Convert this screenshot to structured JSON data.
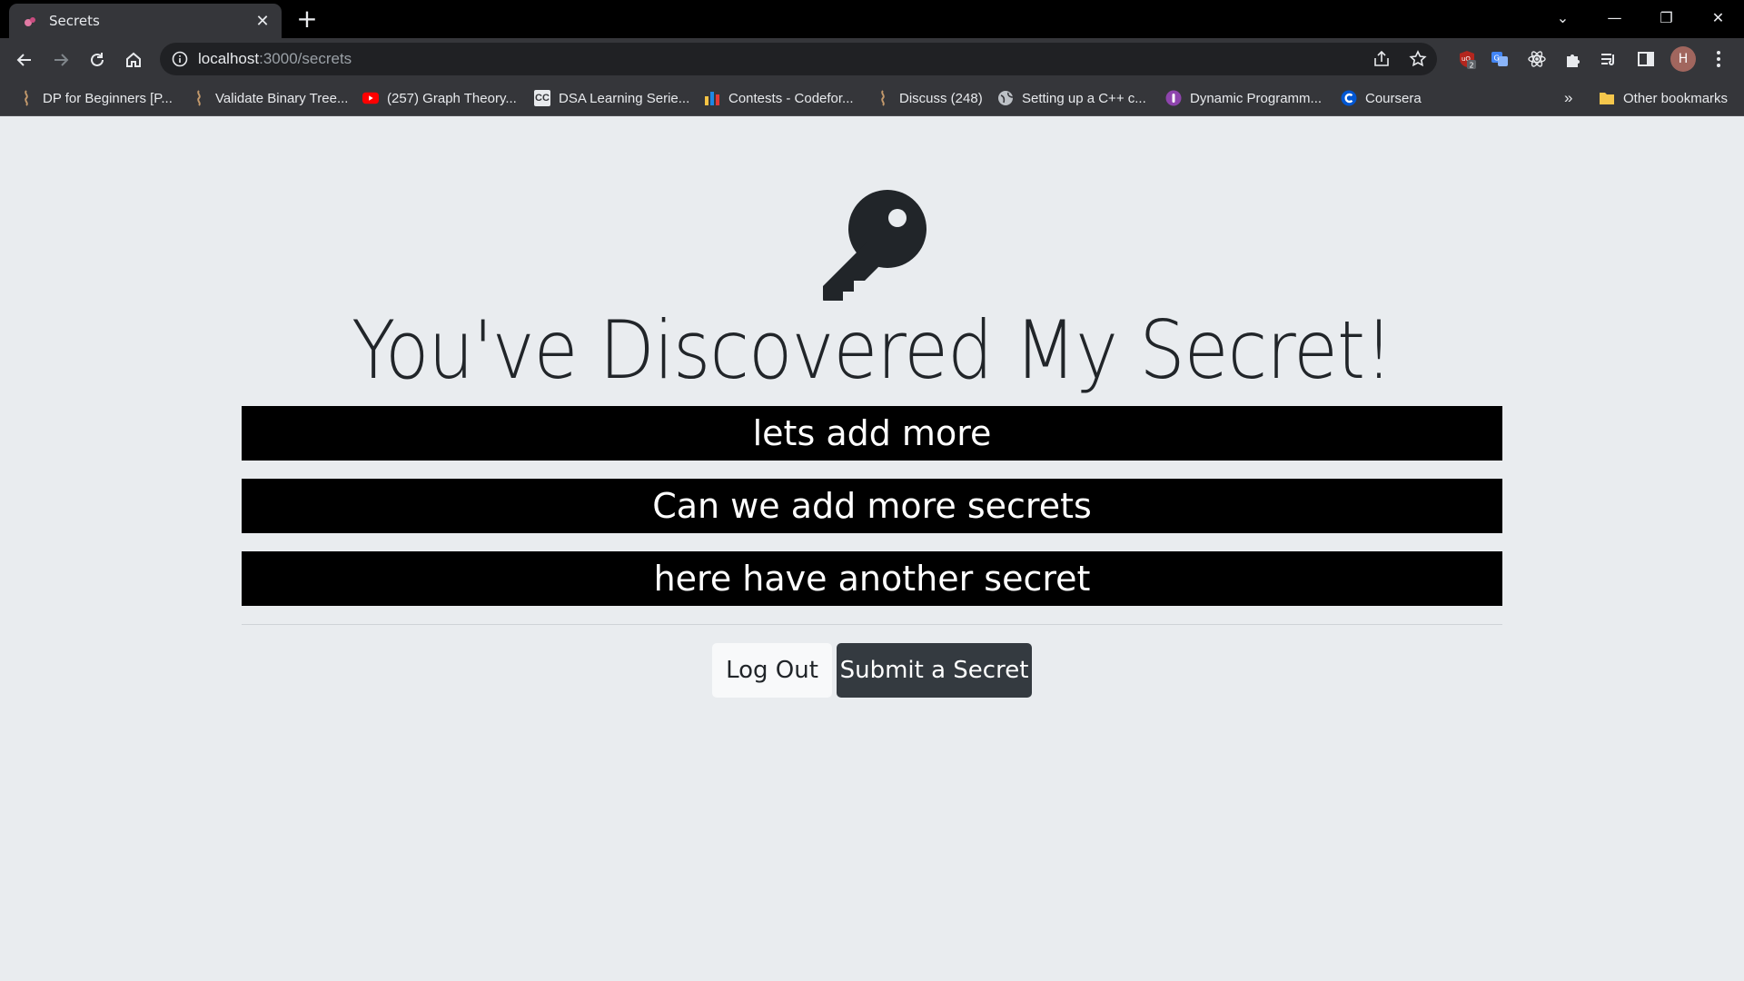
{
  "browser": {
    "tab": {
      "title": "Secrets",
      "close": "✕"
    },
    "new_tab": "+",
    "window_controls": [
      "⌄",
      "—",
      "❐",
      "✕"
    ],
    "address": {
      "host": "localhost",
      "path": ":3000/secrets"
    },
    "extension_badge": "2",
    "profile_initial": "H",
    "bookmarks": [
      {
        "label": "DP for Beginners [P...",
        "icon": "codechef-icon"
      },
      {
        "label": "Validate Binary Tree...",
        "icon": "codechef-icon"
      },
      {
        "label": "(257) Graph Theory...",
        "icon": "youtube-icon"
      },
      {
        "label": "DSA Learning Serie...",
        "icon": "cc-icon"
      },
      {
        "label": "Contests - Codefor...",
        "icon": "codeforces-icon"
      },
      {
        "label": "Discuss (248)",
        "icon": "codechef-icon"
      },
      {
        "label": "Setting up a C++ c...",
        "icon": "globe-icon"
      },
      {
        "label": "Dynamic Programm...",
        "icon": "purple-icon"
      },
      {
        "label": "Coursera",
        "icon": "coursera-icon"
      }
    ],
    "overflow": "»",
    "other_bookmarks": "Other bookmarks"
  },
  "page": {
    "headline": "You've Discovered My Secret!",
    "secrets": [
      "lets add more",
      "Can we add more secrets",
      "here have another secret"
    ],
    "logout_label": "Log Out",
    "submit_label": "Submit a Secret"
  },
  "colors": {
    "background": "#e9ecef",
    "secret_bg": "#000000",
    "dark_button": "#343a40",
    "light_button": "#f8f9fa"
  }
}
